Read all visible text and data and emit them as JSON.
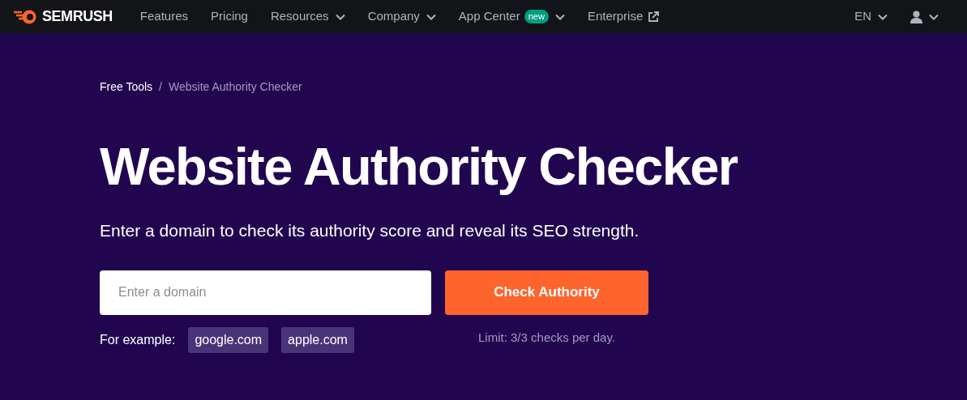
{
  "nav": {
    "logo": "SEMRUSH",
    "items": [
      {
        "label": "Features",
        "kind": "plain"
      },
      {
        "label": "Pricing",
        "kind": "plain"
      },
      {
        "label": "Resources",
        "kind": "dropdown"
      },
      {
        "label": "Company",
        "kind": "dropdown"
      },
      {
        "label": "App Center",
        "kind": "dropdown",
        "badge": "new"
      },
      {
        "label": "Enterprise",
        "kind": "external"
      }
    ],
    "language": "EN"
  },
  "breadcrumb_separator": "/",
  "breadcrumb": [
    {
      "label": "Free Tools",
      "current": false
    },
    {
      "label": "Website Authority Checker",
      "current": true
    }
  ],
  "title": "Website Authority Checker",
  "subtitle": "Enter a domain to check its authority score and reveal its SEO strength.",
  "search": {
    "placeholder": "Enter a domain",
    "button": "Check Authority",
    "limit": "Limit: 3/3 checks per day."
  },
  "examples": {
    "label": "For example:",
    "items": [
      "google.com",
      "apple.com"
    ]
  }
}
